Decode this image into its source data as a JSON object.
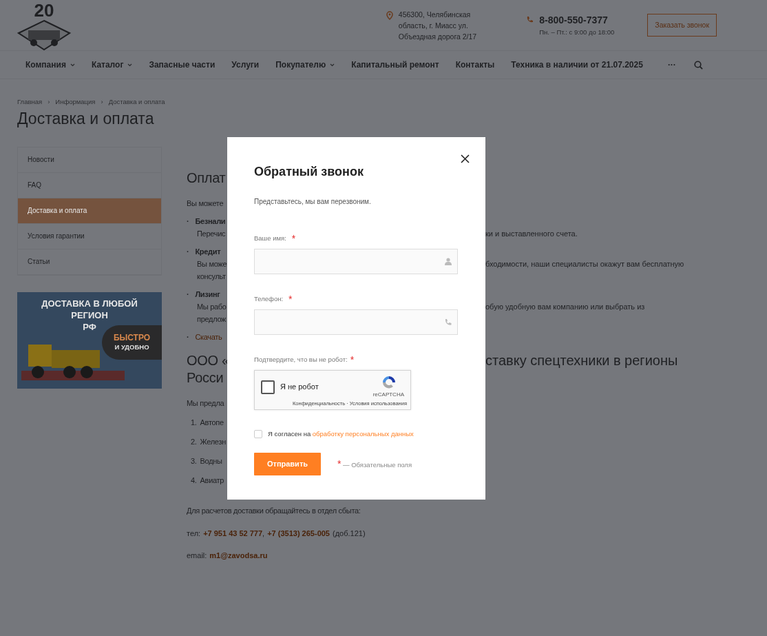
{
  "header": {
    "logo_text": "20",
    "address": [
      "456300, Челябинская",
      "область, г. Миасс ул.",
      "Объездная дорога 2/17"
    ],
    "phone": "8-800-550-7377",
    "hours": "Пн. – Пт.: с 9:00 до 18:00",
    "callback_button": "Заказать звонок"
  },
  "nav": [
    {
      "label": "Компания",
      "dropdown": true
    },
    {
      "label": "Каталог",
      "dropdown": true
    },
    {
      "label": "Запасные части",
      "dropdown": false
    },
    {
      "label": "Услуги",
      "dropdown": false
    },
    {
      "label": "Покупателю",
      "dropdown": true
    },
    {
      "label": "Капитальный ремонт",
      "dropdown": false
    },
    {
      "label": "Контакты",
      "dropdown": false
    },
    {
      "label": "Техника в наличии от 21.07.2025",
      "dropdown": false
    },
    {
      "label": "···",
      "dropdown": false
    }
  ],
  "breadcrumbs": [
    {
      "label": "Главная"
    },
    {
      "separator": "›",
      "label": "Информация"
    },
    {
      "separator": "›",
      "label": "Доставка и оплата"
    }
  ],
  "page_title": "Доставка и оплата",
  "sidebar": {
    "items": [
      {
        "label": "Новости",
        "selected": false
      },
      {
        "label": "FAQ",
        "selected": false
      },
      {
        "label": "Доставка и оплата",
        "selected": true
      },
      {
        "label": "Условия гарантии",
        "selected": false
      },
      {
        "label": "Статьи",
        "selected": false
      }
    ],
    "banner": {
      "lines": [
        "ДОСТАВКА В ЛЮБОЙ",
        "РЕГИОН",
        "РФ"
      ],
      "badge": [
        "БЫСТРО",
        "И УДОБНО"
      ]
    }
  },
  "content": [
    {
      "kind": "heading",
      "left": "Оплат"
    },
    {
      "kind": "text",
      "left": "Вы можете"
    },
    {
      "kind": "bullet",
      "marker": "·",
      "left": "Безнали"
    },
    {
      "kind": "subtext",
      "left": "Перечис",
      "right": "ки и выставленного счета."
    },
    {
      "kind": "bullet",
      "marker": "·",
      "left": "Кредит"
    },
    {
      "kind": "subtext",
      "left": "Вы може",
      "right": "бходимости, наши специалисты окажут вам бесплатную"
    },
    {
      "kind": "subtext",
      "left": "консульт"
    },
    {
      "kind": "bullet",
      "marker": "·",
      "left": "Лизинг"
    },
    {
      "kind": "subtext",
      "left": "Мы рабо",
      "right": "обую удобную вам компанию или выбрать из"
    },
    {
      "kind": "subtext",
      "left": "предлож"
    },
    {
      "kind": "bulletlink",
      "marker": "·",
      "left": "Скачать"
    },
    {
      "kind": "heading",
      "left": "ООО «",
      "right": "ставку спецтехники в регионы"
    },
    {
      "kind": "heading2",
      "left": "Росси"
    },
    {
      "kind": "text",
      "left": "Мы предла"
    },
    {
      "kind": "numbered",
      "num": "1.",
      "left": "Автопе"
    },
    {
      "kind": "numbered",
      "num": "2.",
      "left": "Железн"
    },
    {
      "kind": "numbered",
      "num": "3.",
      "left": "Водны"
    },
    {
      "kind": "numbered",
      "num": "4.",
      "left": "Авиатр"
    },
    {
      "kind": "text",
      "left": "Для расчетов доставки обращайтесь в отдел сбыта:"
    }
  ],
  "contacts": {
    "phone_label": "тел:",
    "phones": [
      "+7 951 43 52 777",
      "+7 (3513) 265-005"
    ],
    "separator": ",",
    "ext": "(доб.121)",
    "email_label": "email:",
    "email": "m1@zavodsa.ru"
  },
  "modal": {
    "title": "Обратный звонок",
    "subtitle": "Представьтесь, мы вам перезвоним.",
    "fields": [
      {
        "label": "Ваше имя:",
        "required": true
      },
      {
        "label": "Телефон:",
        "required": true
      }
    ],
    "captcha": {
      "label": "Подтвердите, что вы не робот:",
      "text": "Я не робот",
      "checked": false,
      "brand": "reCAPTCHA",
      "links": "Конфиденциальность · Условия использования"
    },
    "consent": {
      "checked": false,
      "text": "Я согласен на",
      "link": "обработку персональных данных"
    },
    "submit": "Отправить",
    "required_note": "— Обязательные поля",
    "asterisk": "*"
  }
}
